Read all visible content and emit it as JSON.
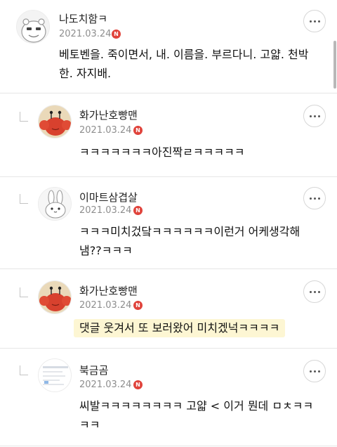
{
  "comments": [
    {
      "nickname": "나도치함ㅋ",
      "date": "2021.03.24",
      "badge": "N",
      "text_lines": [
        "베토벤을. 죽이면서, 내. 이름을. 부르다니. 고얇. 천박",
        "한. 자지배."
      ],
      "avatar": "hamster-avatar",
      "reply": false
    },
    {
      "nickname": "화가난호빵맨",
      "date": "2021.03.24",
      "badge": "N",
      "text_lines": [
        "ㅋㅋㅋㅋㅋㅋㅋ아진짝ㄹㅋㅋㅋㅋㅋ"
      ],
      "avatar": "crab-avatar",
      "reply": true
    },
    {
      "nickname": "이마트삼겹살",
      "date": "2021.03.24",
      "badge": "N",
      "text_lines": [
        "ㅋㅋㅋ미치겄닼ㅋㅋㅋㅋㅋㅋ이런거 어케생각해",
        "냄??ㅋㅋㅋ"
      ],
      "avatar": "rabbit-avatar",
      "reply": true
    },
    {
      "nickname": "화가난호빵맨",
      "date": "2021.03.24",
      "badge": "N",
      "text_lines": [
        "댓글 웃겨서 또 보러왔어 미치겠넉ㅋㅋㅋㅋ"
      ],
      "avatar": "crab-avatar",
      "reply": true,
      "highlighted": true
    },
    {
      "nickname": "북금곰",
      "date": "2021.03.24",
      "badge": "N",
      "text_lines": [
        "씨발ㅋㅋㅋㅋㅋㅋㅋㅋ 고얇 < 이거 뭔데 ㅁㅊㅋㅋ",
        "ㅋㅋ"
      ],
      "avatar": "document-avatar",
      "reply": true
    }
  ],
  "colors": {
    "badge": "#e0433b",
    "highlight": "#fdf6d3",
    "date": "#8e8e8e",
    "divider": "#e6e6e6"
  },
  "icons": {
    "more": "more-dots-icon",
    "reply": "reply-arrow-icon"
  }
}
